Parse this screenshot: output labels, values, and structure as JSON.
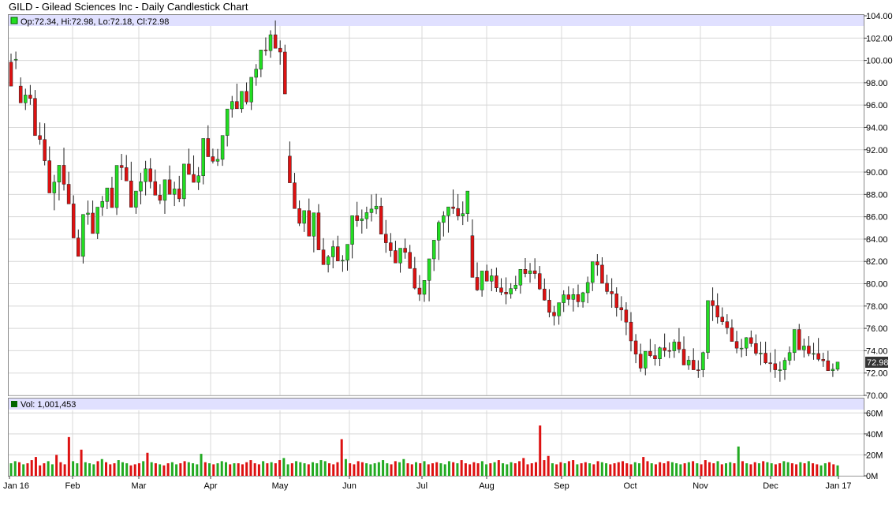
{
  "title": "GILD - Gilead Sciences Inc - Daily Candlestick Chart",
  "ohlc_legend": "Op:72.34, Hi:72.98, Lo:72.18, Cl:72.98",
  "volume_legend": "Vol: 1,001,453",
  "last_price_label": "72.98",
  "colors": {
    "up": "#22dd22",
    "down": "#dd1111",
    "vol_up": "#22aa22",
    "vol_down": "#dd1111",
    "legend_bg": "#e0e0ff",
    "grid": "#d8d8d8"
  },
  "chart_data": [
    {
      "type": "candlestick",
      "ylim": [
        70,
        104
      ],
      "yticks": [
        "104.00",
        "102.00",
        "100.00",
        "98.00",
        "96.00",
        "94.00",
        "92.00",
        "90.00",
        "88.00",
        "86.00",
        "84.00",
        "82.00",
        "80.00",
        "78.00",
        "76.00",
        "74.00",
        "72.00",
        "70.00"
      ],
      "series": {
        "open": [
          99.85,
          100.1,
          97.7,
          96.2,
          96.9,
          96.6,
          93.27,
          92.92,
          91.02,
          88.13,
          89.1,
          90.61,
          88.91,
          87.15,
          84.1,
          82.45,
          86.21,
          86.33,
          84.5,
          86.86,
          87.37,
          88.58,
          86.82,
          90.6,
          90.4,
          89.21,
          86.85,
          88.3,
          89.14,
          90.3,
          89.15,
          87.93,
          87.47,
          89.31,
          88.01,
          88.49,
          87.61,
          90.72,
          89.79,
          89.08,
          89.67,
          93.01,
          91.38,
          90.97,
          91.14,
          93.28,
          95.65,
          96.32,
          95.67,
          97.23,
          96.28,
          98.49,
          99.22,
          100.94,
          100.88,
          102.3,
          101.09,
          100.75,
          91.43,
          89.04,
          86.73,
          85.41,
          86.55,
          84.26,
          86.35,
          83.03,
          81.71,
          82.41,
          83.32,
          82.04,
          82.1,
          83.53,
          86.09,
          85.65,
          85.82,
          86.37,
          86.69,
          86.95,
          84.44,
          83.67,
          82.97,
          81.86,
          83.18,
          82.81,
          81.37,
          79.61,
          79.05,
          80.3,
          82.23,
          83.9,
          85.49,
          86.09,
          86.88,
          86.74,
          86.07,
          86.28,
          84.3,
          80.57,
          79.44,
          81.14,
          80.23,
          80.71,
          79.63,
          79.24,
          79.08,
          79.57,
          79.88,
          81.29,
          80.91,
          81.16,
          80.91,
          79.53,
          78.53,
          77.44,
          77.12,
          78.3,
          79.01,
          78.6,
          79.03,
          78.38,
          79.19,
          80.11,
          81.97,
          81.67,
          80.04,
          79.3,
          79.1,
          77.86,
          77.65,
          76.56,
          74.88,
          73.69,
          72.44,
          73.95,
          73.56,
          73.27,
          74.26,
          74.02,
          73.99,
          74.78,
          74.13,
          72.72,
          73.15,
          72.29,
          72.28,
          73.83,
          78.49,
          78.04,
          77.01,
          76.6,
          76.05,
          74.83,
          74.23,
          74.23,
          75.17,
          74.64,
          73.76,
          73.78,
          72.92,
          72.84,
          72.29,
          72.29,
          73.14,
          73.83,
          75.9,
          74.08,
          74.42,
          73.74,
          73.75,
          73.23,
          73.1,
          72.21,
          72.34
        ],
        "high": [
          100.62,
          100.79,
          98.48,
          97.47,
          97.8,
          97.35,
          94.45,
          94.37,
          92.3,
          89.75,
          90.5,
          92.18,
          90.03,
          87.92,
          84.86,
          83.39,
          87.45,
          87.45,
          86.04,
          87.86,
          88.49,
          89.58,
          88.38,
          91.63,
          91.53,
          90.93,
          88.25,
          89.94,
          91.01,
          91.25,
          90.23,
          88.92,
          88.92,
          90.59,
          89.14,
          89.66,
          88.81,
          92.1,
          91.49,
          90.45,
          91.05,
          94.19,
          92.1,
          92.07,
          92.53,
          94.41,
          96.82,
          97.92,
          96.53,
          98.03,
          97.6,
          99.67,
          100.52,
          102.06,
          102.7,
          103.58,
          101.79,
          101.41,
          92.74,
          89.93,
          87.46,
          86.55,
          87.63,
          85.29,
          87.13,
          84.08,
          82.58,
          83.88,
          84.3,
          82.56,
          82.82,
          84.47,
          87.34,
          86.65,
          86.9,
          87.99,
          88.05,
          87.7,
          85.71,
          84.54,
          83.85,
          82.85,
          84.04,
          83.48,
          82.4,
          80.77,
          80.02,
          81.23,
          83.67,
          85.66,
          86.49,
          86.87,
          88.44,
          88.03,
          87.37,
          87.92,
          85.76,
          81.91,
          80.56,
          81.71,
          81.33,
          81.44,
          80.49,
          80.57,
          80.05,
          80.71,
          80.75,
          82.3,
          81.86,
          82.28,
          81.59,
          80.47,
          79.51,
          78.01,
          78.13,
          79.41,
          79.77,
          79.59,
          79.93,
          79.27,
          80.64,
          81.3,
          82.65,
          82.37,
          80.81,
          80.49,
          79.68,
          78.88,
          78.34,
          77.46,
          75.49,
          74.63,
          73.72,
          75.05,
          74.58,
          74.37,
          75.54,
          74.74,
          75.02,
          76.03,
          75.28,
          73.54,
          74.22,
          73.14,
          73.92,
          74.96,
          79.67,
          79.14,
          77.88,
          77.27,
          76.81,
          75.78,
          75.06,
          75.21,
          75.81,
          75.46,
          74.81,
          74.81,
          73.83,
          74.14,
          73.03,
          73.39,
          74.38,
          75.49,
          76.4,
          75.08,
          75.3,
          74.71,
          75.14,
          73.82,
          73.99,
          72.86,
          72.98
        ],
        "low": [
          98.51,
          99.22,
          96.57,
          95.56,
          96.03,
          94.52,
          92.45,
          90.6,
          88.48,
          86.58,
          87.46,
          88.35,
          87.61,
          85.65,
          83.39,
          81.81,
          85.29,
          85.27,
          84.0,
          86.07,
          86.68,
          88.18,
          86.16,
          89.29,
          89.4,
          88.46,
          86.26,
          87.11,
          87.91,
          88.54,
          88.48,
          87.14,
          86.26,
          88.55,
          86.96,
          87.31,
          86.93,
          90.14,
          89.18,
          88.39,
          88.9,
          92.0,
          90.77,
          90.55,
          90.56,
          92.3,
          94.88,
          95.82,
          95.32,
          96.06,
          95.56,
          97.73,
          98.5,
          100.43,
          100.24,
          101.21,
          99.62,
          99.82,
          89.43,
          87.16,
          85.17,
          84.64,
          84.88,
          82.81,
          84.59,
          82.15,
          81.01,
          81.38,
          82.13,
          81.06,
          81.17,
          82.27,
          85.1,
          84.49,
          84.93,
          85.58,
          86.24,
          85.28,
          82.77,
          82.4,
          82.4,
          80.99,
          82.24,
          81.34,
          79.49,
          78.46,
          78.38,
          78.42,
          81.14,
          82.12,
          84.23,
          84.58,
          86.26,
          85.67,
          85.26,
          85.56,
          81.63,
          79.35,
          78.84,
          80.21,
          79.33,
          79.27,
          78.97,
          78.16,
          78.66,
          79.35,
          79.11,
          80.58,
          80.09,
          80.44,
          79.45,
          78.49,
          76.99,
          76.26,
          76.33,
          77.47,
          78.06,
          77.51,
          77.9,
          77.86,
          78.26,
          79.34,
          80.71,
          80.17,
          79.04,
          77.85,
          77.06,
          76.68,
          75.39,
          73.94,
          72.89,
          72.11,
          71.8,
          73.41,
          72.67,
          72.62,
          73.45,
          73.34,
          73.36,
          73.8,
          73.07,
          72.28,
          72.31,
          71.57,
          71.63,
          73.25,
          76.66,
          76.43,
          76.3,
          75.49,
          74.9,
          73.77,
          73.41,
          73.53,
          74.34,
          73.57,
          72.7,
          72.81,
          72.08,
          71.57,
          71.22,
          71.39,
          72.72,
          73.11,
          74.99,
          73.39,
          73.51,
          73.19,
          73.06,
          72.55,
          72.5,
          71.65,
          72.18
        ],
        "close": [
          97.7,
          100.1,
          96.2,
          96.9,
          96.6,
          93.27,
          92.92,
          91.02,
          88.13,
          89.1,
          90.61,
          88.91,
          87.15,
          84.1,
          82.45,
          86.21,
          86.33,
          84.5,
          86.86,
          87.37,
          88.58,
          86.82,
          90.6,
          90.4,
          89.21,
          86.85,
          88.3,
          89.14,
          90.3,
          89.15,
          87.93,
          87.47,
          89.31,
          88.01,
          88.49,
          87.61,
          90.72,
          89.79,
          89.08,
          89.67,
          93.01,
          91.38,
          90.97,
          91.14,
          93.28,
          95.65,
          96.32,
          95.67,
          97.23,
          96.28,
          98.49,
          99.22,
          100.94,
          100.88,
          102.3,
          101.09,
          100.75,
          97.0,
          89.04,
          86.73,
          85.41,
          86.55,
          84.26,
          86.35,
          83.03,
          81.71,
          82.41,
          83.32,
          82.04,
          82.1,
          83.53,
          86.09,
          85.65,
          85.82,
          86.37,
          86.69,
          86.95,
          84.44,
          83.67,
          82.97,
          81.86,
          83.18,
          82.81,
          81.37,
          79.61,
          79.05,
          80.3,
          82.23,
          83.9,
          85.49,
          86.09,
          86.88,
          86.74,
          86.07,
          86.28,
          88.3,
          80.57,
          79.44,
          81.14,
          80.23,
          80.71,
          79.63,
          79.24,
          79.08,
          79.57,
          79.88,
          81.29,
          80.91,
          81.16,
          80.91,
          79.53,
          78.53,
          77.44,
          77.12,
          78.3,
          79.01,
          78.6,
          79.03,
          78.38,
          79.19,
          80.11,
          81.97,
          81.67,
          80.04,
          79.3,
          79.1,
          77.86,
          77.65,
          76.56,
          74.88,
          73.69,
          72.44,
          73.95,
          73.56,
          73.27,
          74.26,
          74.02,
          73.99,
          74.78,
          74.13,
          72.72,
          73.15,
          72.29,
          72.28,
          73.83,
          78.49,
          78.04,
          77.01,
          76.6,
          76.05,
          74.83,
          74.23,
          74.23,
          75.17,
          74.64,
          73.76,
          73.78,
          72.92,
          72.84,
          72.29,
          72.29,
          73.14,
          73.83,
          75.9,
          74.08,
          74.42,
          73.74,
          73.75,
          73.23,
          73.1,
          72.21,
          72.34,
          72.98
        ]
      }
    },
    {
      "type": "bar",
      "name": "Volume",
      "ylim": [
        0,
        70
      ],
      "yticks": [
        "60M",
        "40M",
        "20M",
        "0M"
      ],
      "values_millions": [
        12,
        14,
        13,
        11,
        12,
        15,
        18,
        10,
        12,
        14,
        11,
        20,
        13,
        11,
        37,
        14,
        12,
        25,
        13,
        12,
        11,
        14,
        16,
        13,
        11,
        12,
        15,
        13,
        12,
        10,
        11,
        12,
        14,
        22,
        13,
        12,
        11,
        10,
        12,
        13,
        11,
        12,
        14,
        13,
        12,
        11,
        21,
        13,
        12,
        11,
        12,
        14,
        13,
        11,
        12,
        12,
        11,
        13,
        15,
        12,
        11,
        14,
        12,
        13,
        12,
        15,
        17,
        11,
        12,
        14,
        13,
        12,
        11,
        13,
        12,
        15,
        14,
        12,
        11,
        13,
        35,
        16,
        12,
        11,
        14,
        13,
        12,
        11,
        12,
        13,
        15,
        12,
        11,
        14,
        13,
        16,
        12,
        11,
        13,
        12,
        14,
        11,
        12,
        13,
        12,
        11,
        14,
        13,
        12,
        15,
        12,
        11,
        13,
        12,
        14,
        11,
        12,
        13,
        15,
        12,
        11,
        13,
        12,
        14,
        17,
        11,
        12,
        13,
        48,
        15,
        19,
        12,
        11,
        13,
        12,
        14,
        15,
        11,
        12,
        13,
        12,
        11,
        14,
        13,
        12,
        11,
        12,
        13,
        14,
        12,
        11,
        13,
        12,
        18,
        14,
        12,
        11,
        13,
        12,
        14,
        13,
        12,
        11,
        12,
        13,
        14,
        12,
        11,
        15,
        13,
        12,
        14,
        11,
        12,
        13,
        12,
        28,
        14,
        12,
        11,
        13,
        12,
        14,
        13,
        12,
        11,
        12,
        14,
        13,
        12,
        11,
        13,
        12,
        14,
        12,
        11,
        10,
        12,
        13,
        11,
        10
      ],
      "up": [
        true,
        true,
        false,
        true,
        false,
        false,
        false,
        false,
        false,
        true,
        true,
        false,
        false,
        false,
        false,
        true,
        true,
        false,
        true,
        true,
        true,
        false,
        true,
        false,
        false,
        false,
        true,
        true,
        true,
        false,
        false,
        false,
        true,
        false,
        true,
        false,
        true,
        false,
        false,
        true,
        true,
        false,
        false,
        true,
        true,
        true,
        true,
        false,
        true,
        false,
        true,
        true,
        true,
        false,
        true,
        false,
        false,
        false,
        false,
        false,
        false,
        true,
        false,
        true,
        false,
        false,
        true,
        true,
        false,
        true,
        true,
        true,
        false,
        true,
        true,
        true,
        true,
        false,
        false,
        false,
        false,
        true,
        false,
        false,
        false,
        false,
        true,
        true,
        true,
        true,
        true,
        true,
        false,
        false,
        true,
        true,
        false,
        false,
        true,
        false,
        true,
        false,
        false,
        false,
        true,
        true,
        true,
        false,
        true,
        false,
        false,
        false,
        false,
        false,
        true,
        true,
        false,
        true,
        false,
        true,
        true,
        true,
        false,
        false,
        false,
        false,
        false,
        false,
        false,
        false,
        false,
        true,
        false,
        false,
        true,
        false,
        false,
        true,
        false,
        false,
        true,
        false,
        false,
        true,
        true,
        false,
        false,
        false,
        false,
        false,
        false,
        true,
        true,
        false,
        false,
        true,
        false,
        false,
        false,
        false,
        true,
        true,
        true,
        false,
        true,
        false,
        true,
        false,
        false,
        false,
        false,
        true,
        false,
        true,
        true,
        false,
        true,
        false,
        true,
        false,
        false,
        true,
        false,
        true,
        true,
        false,
        false,
        true,
        true,
        false,
        false,
        true,
        false,
        true,
        false,
        false,
        true,
        true,
        false,
        false,
        true
      ]
    }
  ],
  "x_axis": {
    "labels": [
      "Jan 16",
      "Feb",
      "Mar",
      "Apr",
      "May",
      "Jun",
      "Jul",
      "Aug",
      "Sep",
      "Oct",
      "Nov",
      "Dec",
      "Jan 17"
    ]
  }
}
